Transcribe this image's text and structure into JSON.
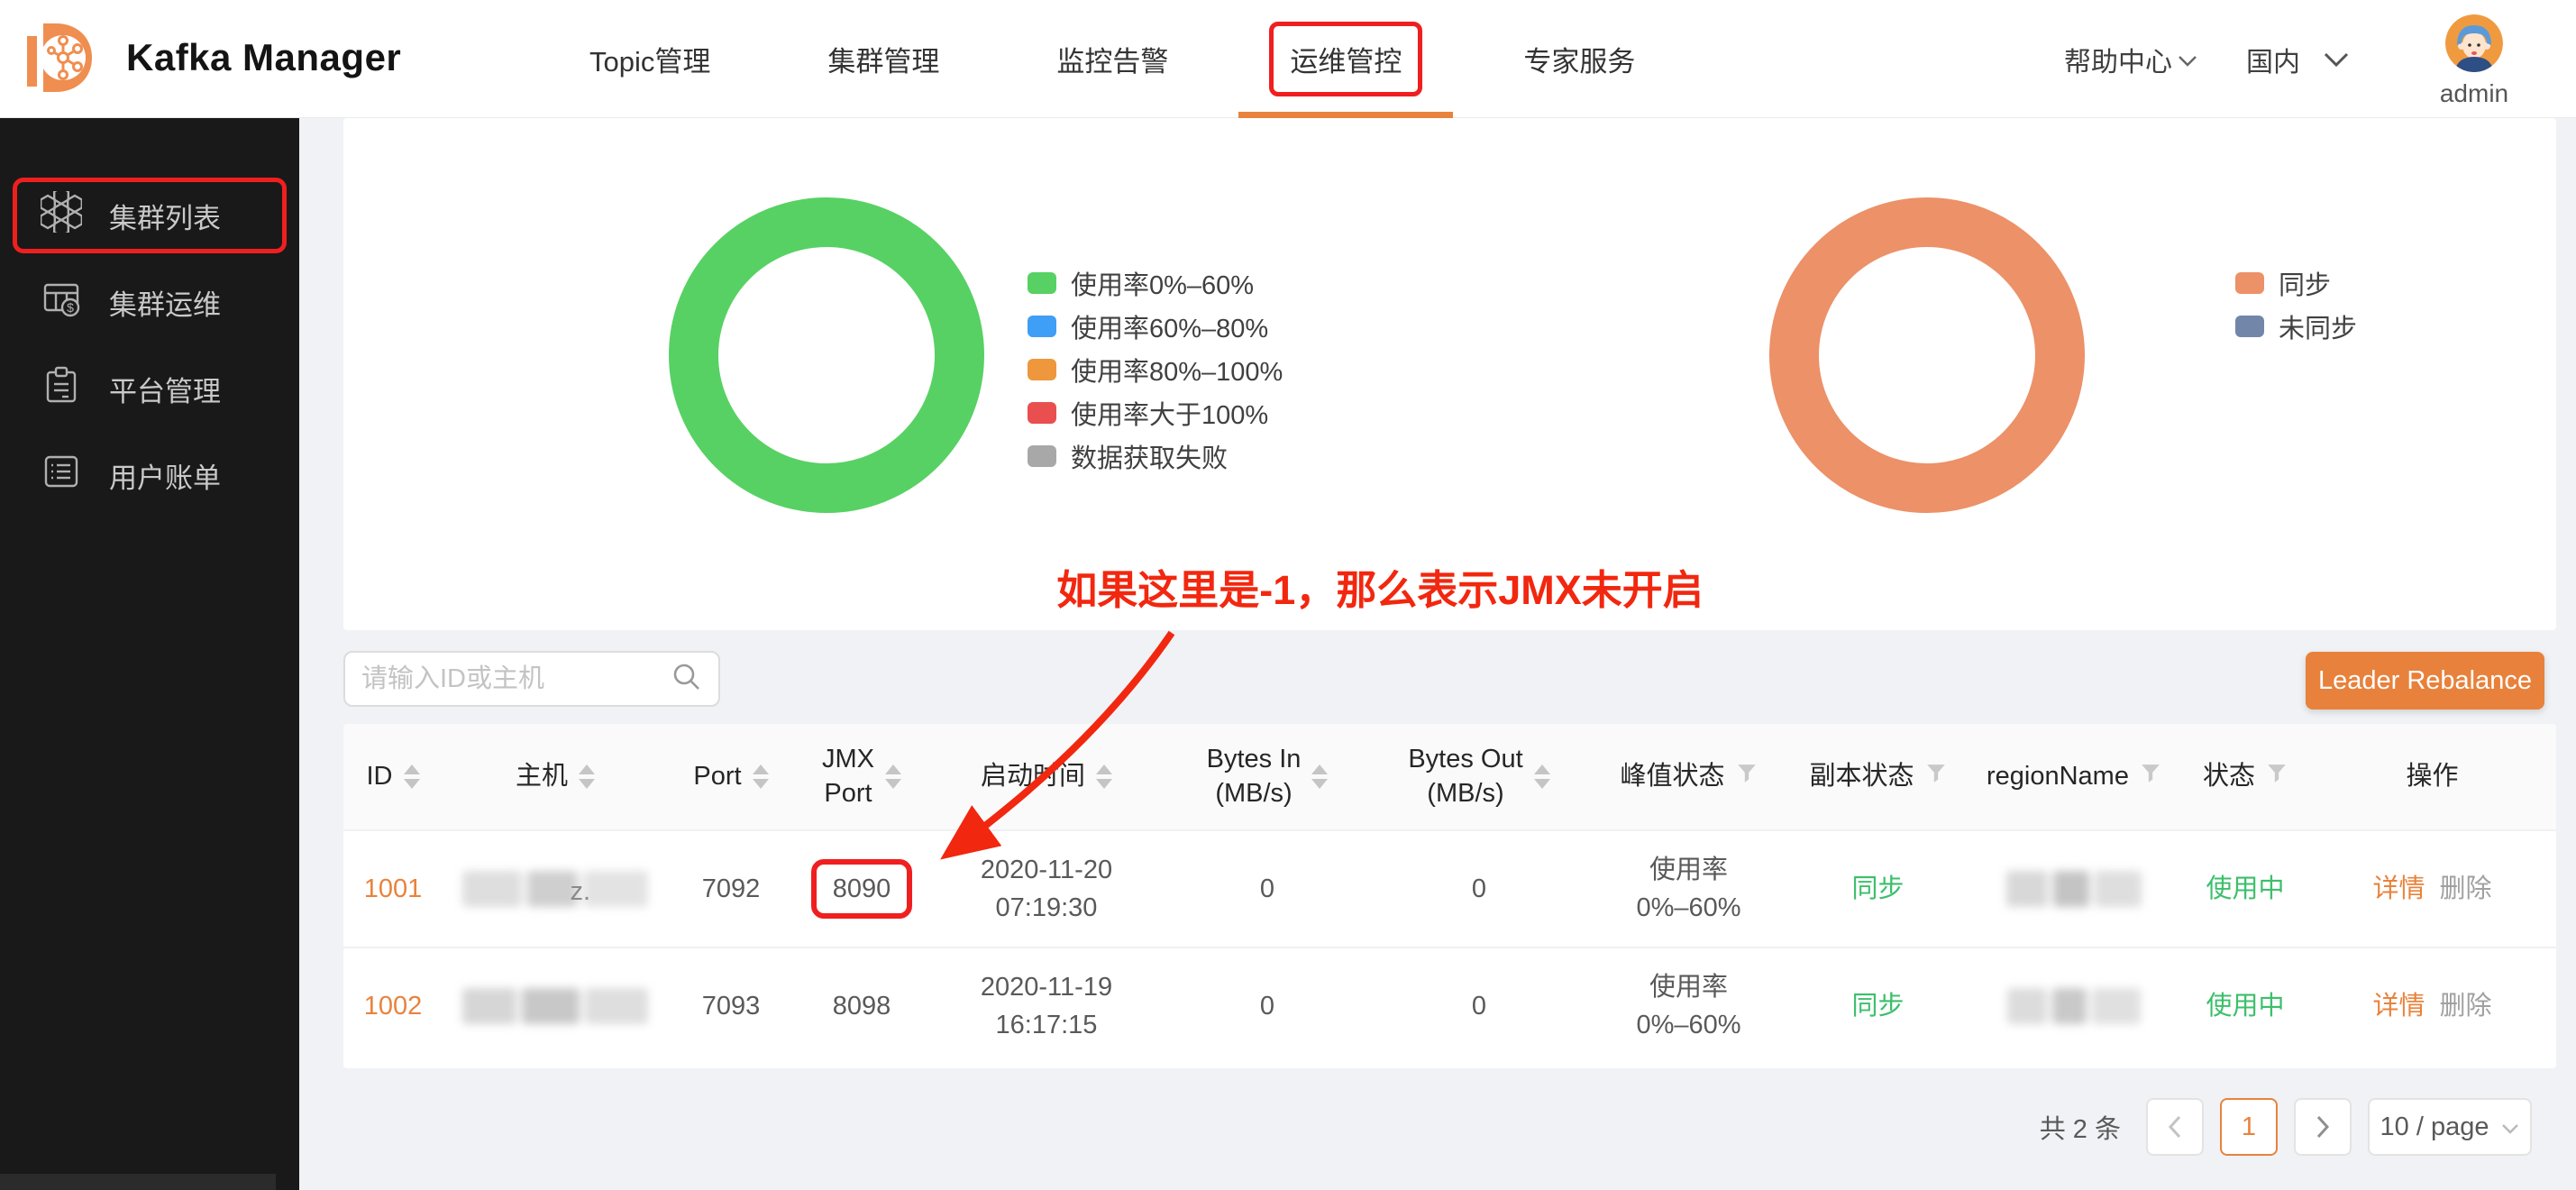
{
  "header": {
    "logo_title": "Kafka Manager",
    "nav": {
      "topic": "Topic管理",
      "cluster": "集群管理",
      "monitor": "监控告警",
      "ops": "运维管控",
      "expert": "专家服务"
    },
    "help": "帮助中心",
    "region": "国内",
    "username": "admin"
  },
  "sidebar": {
    "cluster_list": "集群列表",
    "cluster_ops": "集群运维",
    "platform": "平台管理",
    "user_bill": "用户账单"
  },
  "chart_data": [
    {
      "type": "pie",
      "subtype": "donut",
      "legend_position": "right",
      "slices": [
        {
          "label": "使用率0%–60%",
          "value": 100,
          "color": "#57d163"
        },
        {
          "label": "使用率60%–80%",
          "value": 0,
          "color": "#3f9ef5"
        },
        {
          "label": "使用率80%–100%",
          "value": 0,
          "color": "#ee973c"
        },
        {
          "label": "使用率大于100%",
          "value": 0,
          "color": "#ea4f4f"
        },
        {
          "label": "数据获取失败",
          "value": 0,
          "color": "#a8a8a8"
        }
      ]
    },
    {
      "type": "pie",
      "subtype": "donut",
      "legend_position": "right",
      "slices": [
        {
          "label": "同步",
          "value": 100,
          "color": "#ec9168"
        },
        {
          "label": "未同步",
          "value": 0,
          "color": "#7286aa"
        }
      ]
    }
  ],
  "annotation": {
    "text": "如果这里是-1，那么表示JMX未开启"
  },
  "toolbar": {
    "search_placeholder": "请输入ID或主机",
    "rebalance": "Leader Rebalance"
  },
  "table": {
    "columns": {
      "id": "ID",
      "host": "主机",
      "port": "Port",
      "jmx1": "JMX",
      "jmx2": "Port",
      "start": "启动时间",
      "bin1": "Bytes In",
      "bin2": "(MB/s)",
      "bout1": "Bytes Out",
      "bout2": "(MB/s)",
      "peak": "峰值状态",
      "replica": "副本状态",
      "region": "regionName",
      "status": "状态",
      "action": "操作"
    },
    "rows": [
      {
        "id": "1001",
        "host_fragment": "z.",
        "port": "7092",
        "jmx": "8090",
        "date": "2020-11-20",
        "time": "07:19:30",
        "bytes_in": "0",
        "bytes_out": "0",
        "peak1": "使用率",
        "peak2": "0%–60%",
        "replica": "同步",
        "status": "使用中",
        "action_detail": "详情",
        "action_delete": "删除"
      },
      {
        "id": "1002",
        "host_fragment": "",
        "port": "7093",
        "jmx": "8098",
        "date": "2020-11-19",
        "time": "16:17:15",
        "bytes_in": "0",
        "bytes_out": "0",
        "peak1": "使用率",
        "peak2": "0%–60%",
        "replica": "同步",
        "status": "使用中",
        "action_detail": "详情",
        "action_delete": "删除"
      }
    ]
  },
  "pagination": {
    "total": "共 2 条",
    "page": "1",
    "page_size": "10 / page"
  },
  "colors": {
    "accent_orange": "#e8813b",
    "link_orange": "#e8833c",
    "status_green": "#3cbf6b",
    "highlight_red": "#f01f1f",
    "annotation_red": "#f2270f",
    "sidebar_bg": "#191919",
    "donut_green": "#57d163",
    "donut_orange": "#ec9168"
  }
}
